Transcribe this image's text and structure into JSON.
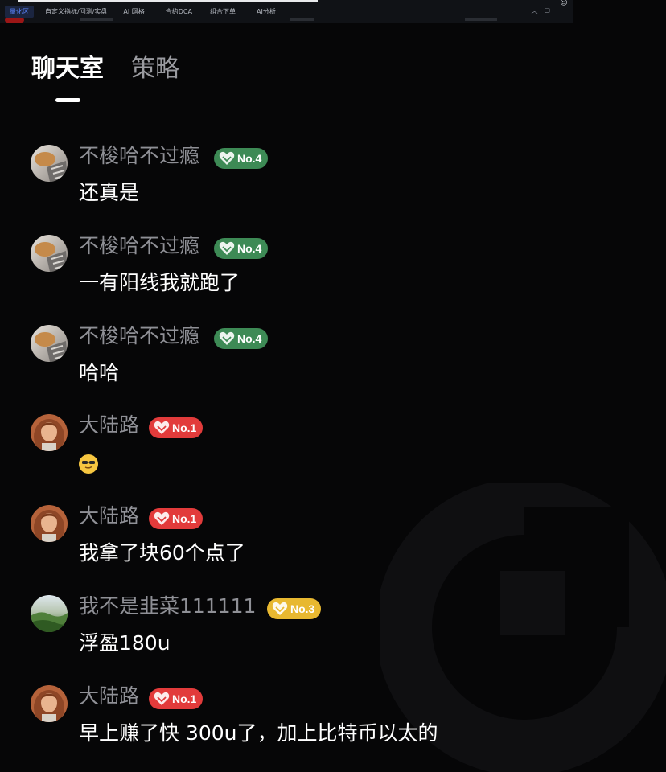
{
  "top_bar": {
    "nav_items": [
      "量化区",
      "自定义指标/回测/实盘",
      "AI 网格",
      "合约DCA",
      "组合下单",
      "AI分析"
    ]
  },
  "tabs": [
    {
      "label": "聊天室"
    },
    {
      "label": "策略"
    }
  ],
  "colors": {
    "badge_green": "#3d8a55",
    "badge_red": "#e23b3b",
    "badge_yellow": "#e8b830",
    "username": "#8f9096",
    "background": "#060607"
  },
  "messages": [
    {
      "user": "不梭哈不过瘾",
      "badge": "No.4",
      "badge_color": "green",
      "avatar": "avatar-cat-icon",
      "text": "还真是"
    },
    {
      "user": "不梭哈不过瘾",
      "badge": "No.4",
      "badge_color": "green",
      "avatar": "avatar-cat-icon",
      "text": "一有阳线我就跑了"
    },
    {
      "user": "不梭哈不过瘾",
      "badge": "No.4",
      "badge_color": "green",
      "avatar": "avatar-cat-icon",
      "text": "哈哈"
    },
    {
      "user": "大陆路",
      "badge": "No.1",
      "badge_color": "red",
      "avatar": "avatar-woman-icon",
      "text": "",
      "emoji": "sunglasses-emoji-icon"
    },
    {
      "user": "大陆路",
      "badge": "No.1",
      "badge_color": "red",
      "avatar": "avatar-woman-icon",
      "text": "我拿了块60个点了"
    },
    {
      "user": "我不是韭菜111111",
      "badge": "No.3",
      "badge_color": "yellow",
      "avatar": "avatar-landscape-icon",
      "text": "浮盈180u"
    },
    {
      "user": "大陆路",
      "badge": "No.1",
      "badge_color": "red",
      "avatar": "avatar-woman-icon",
      "text": "早上赚了快 300u了，加上比特币以太的"
    }
  ]
}
